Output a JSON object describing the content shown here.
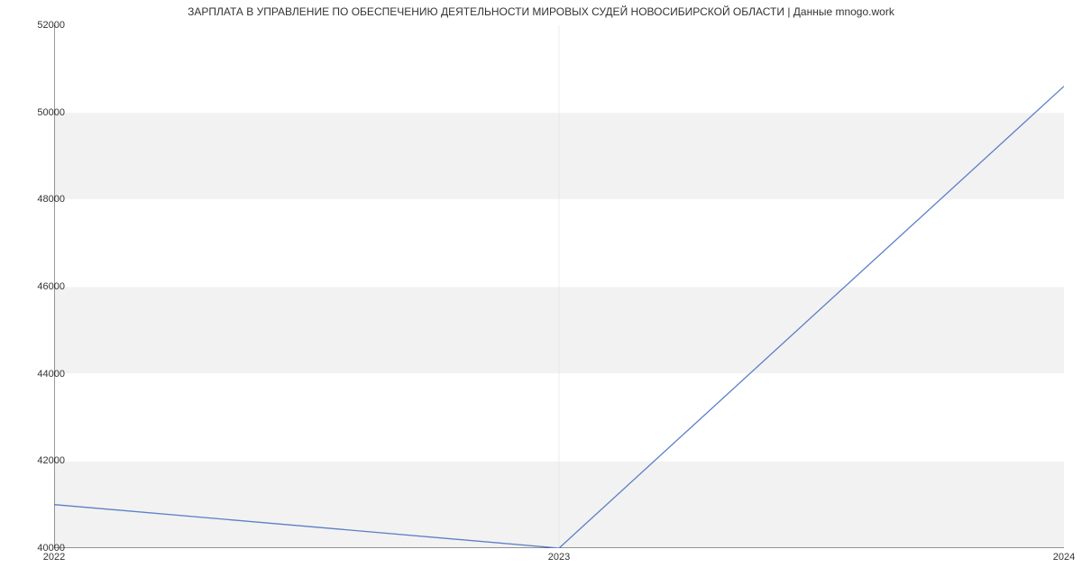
{
  "chart_data": {
    "type": "line",
    "title": "ЗАРПЛАТА В УПРАВЛЕНИЕ ПО ОБЕСПЕЧЕНИЮ ДЕЯТЕЛЬНОСТИ МИРОВЫХ СУДЕЙ НОВОСИБИРСКОЙ ОБЛАСТИ | Данные mnogo.work",
    "x": [
      2022,
      2023,
      2024
    ],
    "values": [
      41000,
      40000,
      50600
    ],
    "xlabel": "",
    "ylabel": "",
    "xlim": [
      2022,
      2024
    ],
    "ylim": [
      40000,
      52000
    ],
    "xticks": [
      2022,
      2023,
      2024
    ],
    "yticks": [
      40000,
      42000,
      44000,
      46000,
      48000,
      50000,
      52000
    ],
    "line_color": "#5b7fc7"
  }
}
